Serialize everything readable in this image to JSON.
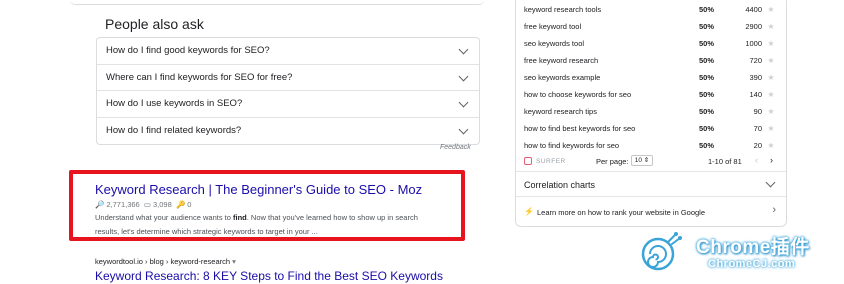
{
  "people_also_ask": {
    "title": "People also ask",
    "questions": [
      "How do I find good keywords for SEO?",
      "Where can I find keywords for SEO for free?",
      "How do I use keywords in SEO?",
      "How do I find related keywords?"
    ],
    "feedback": "Feedback"
  },
  "result1": {
    "title": "Keyword Research | The Beginner's Guide to SEO - Moz",
    "stat1": "2,771,366",
    "stat2": "3,098",
    "stat3": "0",
    "snippet_a": "Understand what your audience wants to ",
    "snippet_bold": "find",
    "snippet_b": ". Now that you've learned how to show up in search",
    "snippet_line2": "results, let's determine which strategic keywords to target in your ..."
  },
  "result2": {
    "cite": "keywordtool.io › blog › keyword-research",
    "title": "Keyword Research: 8 KEY Steps to Find the Best SEO Keywords"
  },
  "keywords_panel": {
    "rows": [
      {
        "keyword": "keyword research tools",
        "pct": "50%",
        "volume": "4400"
      },
      {
        "keyword": "free keyword tool",
        "pct": "50%",
        "volume": "2900"
      },
      {
        "keyword": "seo keywords tool",
        "pct": "50%",
        "volume": "1000"
      },
      {
        "keyword": "free keyword research",
        "pct": "50%",
        "volume": "720"
      },
      {
        "keyword": "seo keywords example",
        "pct": "50%",
        "volume": "390"
      },
      {
        "keyword": "how to choose keywords for seo",
        "pct": "50%",
        "volume": "140"
      },
      {
        "keyword": "keyword research tips",
        "pct": "50%",
        "volume": "90"
      },
      {
        "keyword": "how to find best keywords for seo",
        "pct": "50%",
        "volume": "70"
      },
      {
        "keyword": "how to find keywords for seo",
        "pct": "50%",
        "volume": "20"
      }
    ],
    "brand": "SURFER",
    "per_page_label": "Per page:",
    "per_page_value": "10 ⇕",
    "range": "1-10 of 81",
    "correlation_label": "Correlation charts",
    "learn_label": "Learn more on how to rank your website in Google"
  },
  "watermark": {
    "line1": "Chrome插件",
    "line2": "ChromeCJ.com"
  },
  "colors": {
    "highlight_border": "#e8141d",
    "link": "#1a0dab",
    "watermark": "#3aa4d8"
  }
}
